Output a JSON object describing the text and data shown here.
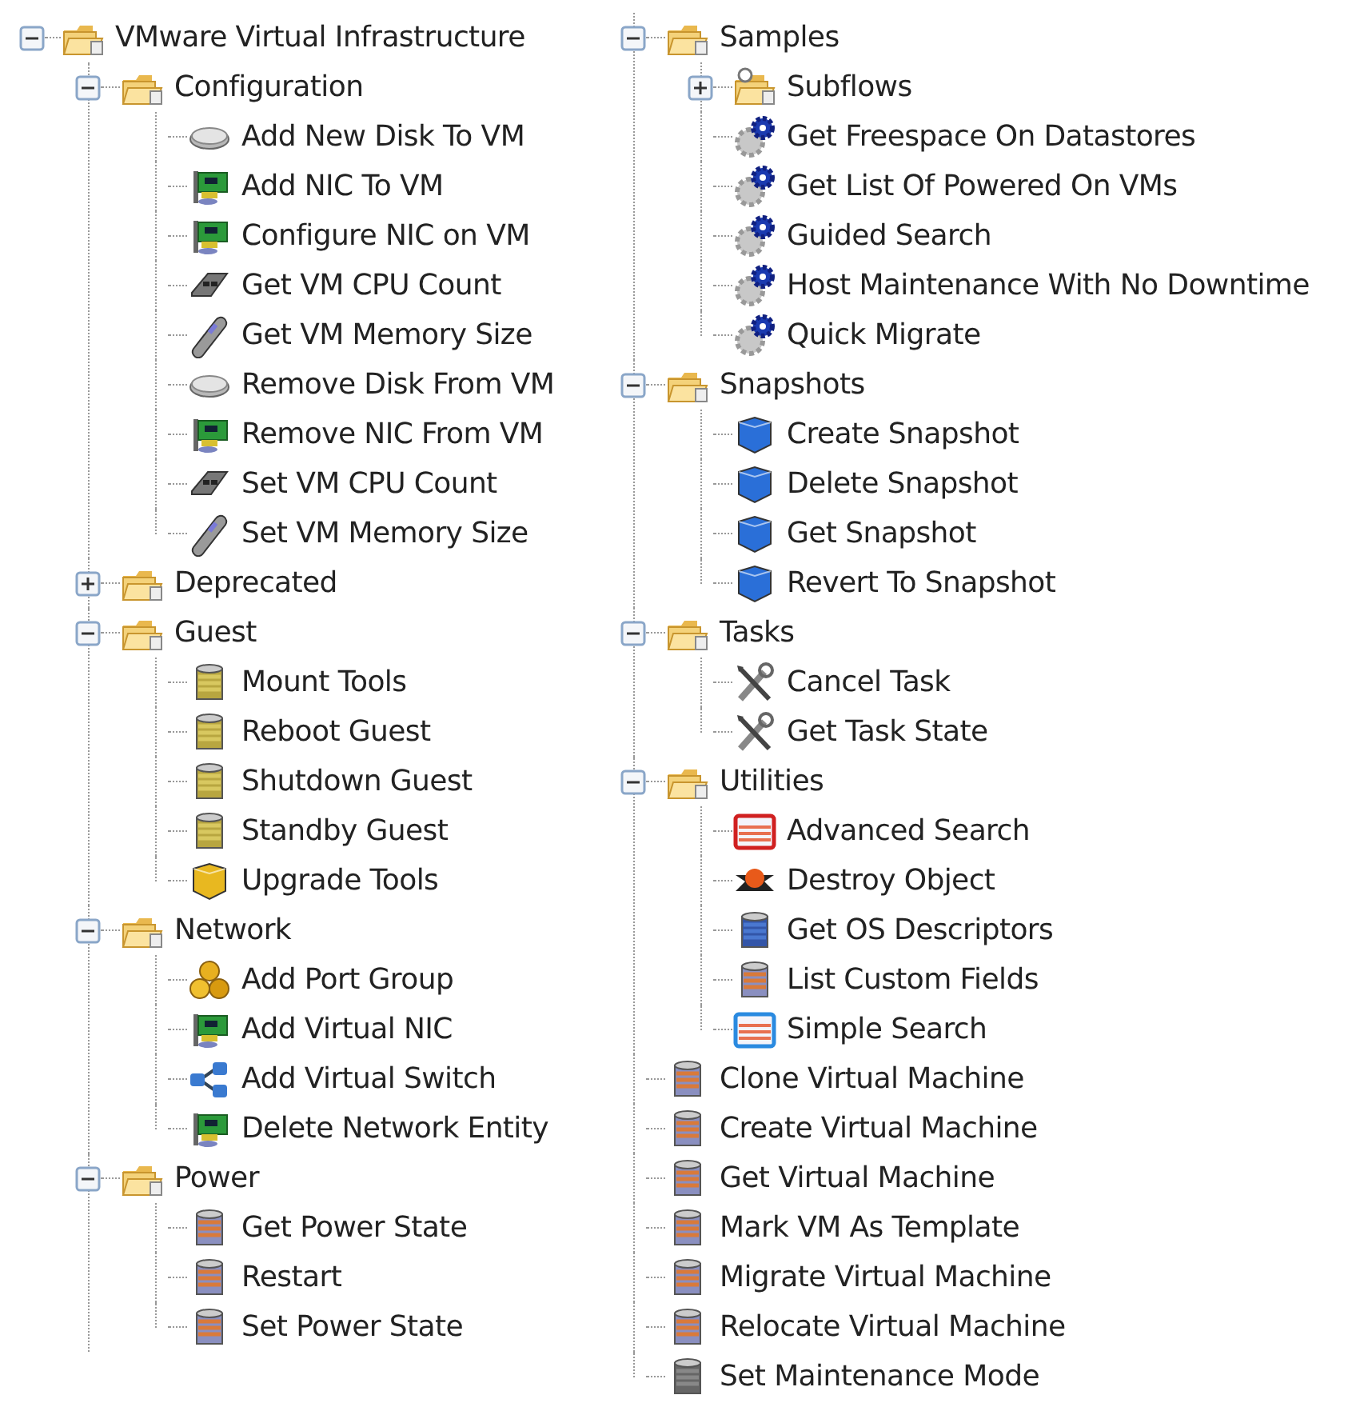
{
  "tree_columns": [
    {
      "nodes": [
        {
          "label": "VMware Virtual Infrastructure",
          "kind": "folder",
          "expanded": true,
          "children": [
            {
              "label": "Configuration",
              "kind": "folder",
              "expanded": true,
              "children": [
                {
                  "label": "Add New Disk To VM",
                  "kind": "disk"
                },
                {
                  "label": "Add NIC To VM",
                  "kind": "nic"
                },
                {
                  "label": "Configure NIC on VM",
                  "kind": "nic"
                },
                {
                  "label": "Get VM CPU Count",
                  "kind": "cpu"
                },
                {
                  "label": "Get VM Memory Size",
                  "kind": "memory"
                },
                {
                  "label": "Remove Disk From VM",
                  "kind": "disk"
                },
                {
                  "label": "Remove NIC From VM",
                  "kind": "nic"
                },
                {
                  "label": "Set VM CPU Count",
                  "kind": "cpu"
                },
                {
                  "label": "Set VM Memory Size",
                  "kind": "memory"
                }
              ]
            },
            {
              "label": "Deprecated",
              "kind": "folder",
              "expanded": false
            },
            {
              "label": "Guest",
              "kind": "folder",
              "expanded": true,
              "children": [
                {
                  "label": "Mount Tools",
                  "kind": "database"
                },
                {
                  "label": "Reboot Guest",
                  "kind": "database"
                },
                {
                  "label": "Shutdown Guest",
                  "kind": "database"
                },
                {
                  "label": "Standby Guest",
                  "kind": "database"
                },
                {
                  "label": "Upgrade Tools",
                  "kind": "package"
                }
              ]
            },
            {
              "label": "Network",
              "kind": "folder",
              "expanded": true,
              "children": [
                {
                  "label": "Add Port Group",
                  "kind": "group"
                },
                {
                  "label": "Add Virtual NIC",
                  "kind": "nic"
                },
                {
                  "label": "Add Virtual Switch",
                  "kind": "switch"
                },
                {
                  "label": "Delete Network Entity",
                  "kind": "nic"
                }
              ]
            },
            {
              "label": "Power",
              "kind": "folder",
              "expanded": true,
              "children": [
                {
                  "label": "Get Power State",
                  "kind": "vm"
                },
                {
                  "label": "Restart",
                  "kind": "vm"
                },
                {
                  "label": "Set Power State",
                  "kind": "vm"
                }
              ]
            }
          ]
        }
      ]
    },
    {
      "nodes": [
        {
          "label": "Samples",
          "kind": "folder",
          "expanded": true,
          "children": [
            {
              "label": "Subflows",
              "kind": "query_folder",
              "expanded": false
            },
            {
              "label": "Get Freespace On Datastores",
              "kind": "workflow"
            },
            {
              "label": "Get List Of Powered On VMs",
              "kind": "workflow"
            },
            {
              "label": "Guided Search",
              "kind": "workflow"
            },
            {
              "label": "Host Maintenance With No Downtime",
              "kind": "workflow"
            },
            {
              "label": "Quick Migrate",
              "kind": "workflow"
            }
          ]
        },
        {
          "label": "Snapshots",
          "kind": "folder",
          "expanded": true,
          "children": [
            {
              "label": "Create Snapshot",
              "kind": "snapshot"
            },
            {
              "label": "Delete Snapshot",
              "kind": "snapshot"
            },
            {
              "label": "Get Snapshot",
              "kind": "snapshot"
            },
            {
              "label": "Revert To Snapshot",
              "kind": "snapshot"
            }
          ]
        },
        {
          "label": "Tasks",
          "kind": "folder",
          "expanded": true,
          "children": [
            {
              "label": "Cancel Task",
              "kind": "tool"
            },
            {
              "label": "Get Task State",
              "kind": "tool"
            }
          ]
        },
        {
          "label": "Utilities",
          "kind": "folder",
          "expanded": true,
          "children": [
            {
              "label": "Advanced Search",
              "kind": "form_red"
            },
            {
              "label": "Destroy Object",
              "kind": "destroy"
            },
            {
              "label": "Get OS Descriptors",
              "kind": "database_blue"
            },
            {
              "label": "List Custom Fields",
              "kind": "vm"
            },
            {
              "label": "Simple Search",
              "kind": "form_blue"
            }
          ]
        },
        {
          "label": "Clone Virtual Machine",
          "kind": "vm"
        },
        {
          "label": "Create Virtual Machine",
          "kind": "vm"
        },
        {
          "label": "Get Virtual Machine",
          "kind": "vm"
        },
        {
          "label": "Mark VM As Template",
          "kind": "vm"
        },
        {
          "label": "Migrate Virtual Machine",
          "kind": "vm"
        },
        {
          "label": "Relocate Virtual Machine",
          "kind": "vm"
        },
        {
          "label": "Set Maintenance Mode",
          "kind": "vm_gray"
        }
      ]
    }
  ]
}
